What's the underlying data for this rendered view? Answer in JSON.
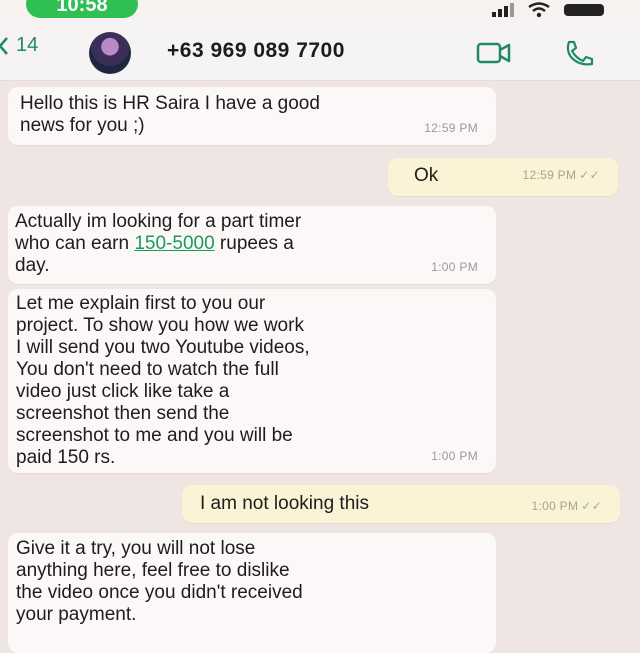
{
  "status": {
    "time": "10:58"
  },
  "header": {
    "back_count": "14",
    "contact": "+63 969 089 7700"
  },
  "messages": [
    {
      "text": "Hello this is HR Saira I have a good\nnews for you ;)",
      "time": "12:59 PM"
    },
    {
      "text": "Ok",
      "time": "12:59 PM"
    },
    {
      "pre": "Actually im looking for a part timer\nwho can earn ",
      "link": "150-5000",
      "post": " rupees a\nday.",
      "time": "1:00 PM"
    },
    {
      "text": "Let me explain first to you our\nproject. To show you how we work\nI will send you two Youtube videos,\nYou don't need to watch the full\nvideo just click like take a\nscreenshot then send the\nscreenshot to me and you will be\npaid 150 rs.",
      "time": "1:00 PM"
    },
    {
      "text": "I am not looking this",
      "time": "1:00 PM"
    },
    {
      "text": "Give it a try, you will not lose\nanything here, feel free to dislike\nthe video once you didn't received\nyour payment."
    }
  ]
}
